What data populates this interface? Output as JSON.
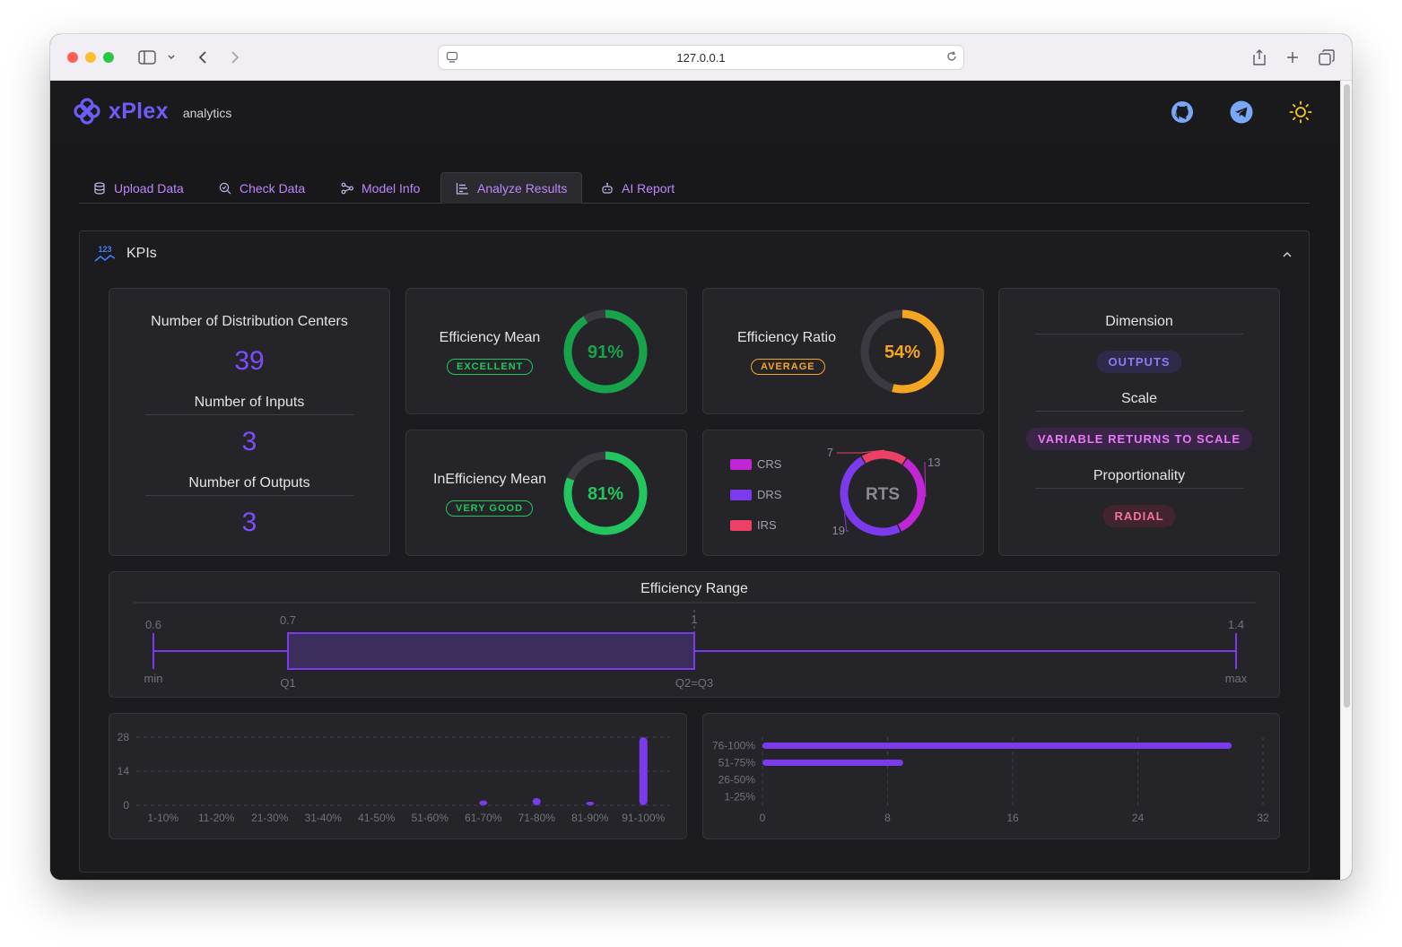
{
  "browser": {
    "url": "127.0.0.1"
  },
  "app": {
    "brand": "xPlex",
    "subtitle": "analytics"
  },
  "tabs": [
    {
      "label": "Upload Data",
      "icon": "database-icon"
    },
    {
      "label": "Check Data",
      "icon": "search-check-icon"
    },
    {
      "label": "Model Info",
      "icon": "workflow-icon"
    },
    {
      "label": "Analyze Results",
      "icon": "chart-report-icon",
      "active": true
    },
    {
      "label": "AI Report",
      "icon": "bot-icon"
    }
  ],
  "kpi_panel": {
    "icon_text": "123",
    "title": "KPIs"
  },
  "counts": {
    "dc_label": "Number of Distribution Centers",
    "dc_value": "39",
    "inputs_label": "Number of Inputs",
    "inputs_value": "3",
    "outputs_label": "Number of Outputs",
    "outputs_value": "3"
  },
  "gauges": [
    {
      "label": "Efficiency Mean",
      "value_text": "91%",
      "value": 0.91,
      "badge": "EXCELLENT",
      "color": "#16a34a",
      "badge_color": "#22c55e"
    },
    {
      "label": "Efficiency Ratio",
      "value_text": "54%",
      "value": 0.54,
      "badge": "AVERAGE",
      "color": "#f5a524",
      "badge_color": "#f5a524"
    },
    {
      "label": "InEfficiency Mean",
      "value_text": "81%",
      "value": 0.81,
      "badge": "VERY GOOD",
      "color": "#22c55e",
      "badge_color": "#22c55e"
    }
  ],
  "rts": {
    "center": "RTS",
    "legend": [
      {
        "name": "CRS",
        "color": "#c026d3"
      },
      {
        "name": "DRS",
        "color": "#7c3aed"
      },
      {
        "name": "IRS",
        "color": "#ec4066"
      }
    ],
    "values": {
      "IRS": 7,
      "CRS": 13,
      "DRS": 19
    }
  },
  "dimension": {
    "dimension_label": "Dimension",
    "dimension_value": "OUTPUTS",
    "scale_label": "Scale",
    "scale_value": "VARIABLE RETURNS TO SCALE",
    "prop_label": "Proportionality",
    "prop_value": "RADIAL"
  },
  "range": {
    "title": "Efficiency Range",
    "min": 0.6,
    "q1": 0.7,
    "median": 1,
    "max": 1.4,
    "labels": {
      "min": "min",
      "q1": "Q1",
      "q2q3": "Q2=Q3",
      "max": "max"
    },
    "ticks": {
      "min": "0.6",
      "q1": "0.7",
      "median": "1",
      "max": "1.4"
    }
  },
  "chart_data": [
    {
      "type": "bar",
      "categories": [
        "1-10%",
        "11-20%",
        "21-30%",
        "31-40%",
        "41-50%",
        "51-60%",
        "61-70%",
        "71-80%",
        "81-90%",
        "91-100%"
      ],
      "values": [
        0,
        0,
        0,
        0,
        0,
        0,
        2,
        3,
        0.5,
        28
      ],
      "yticks": [
        0,
        14,
        28
      ],
      "ylim": [
        0,
        28
      ],
      "color": "#7c3aed"
    },
    {
      "type": "bar",
      "orientation": "horizontal",
      "categories": [
        "76-100%",
        "51-75%",
        "26-50%",
        "1-25%"
      ],
      "values": [
        30,
        9,
        0,
        0
      ],
      "xticks": [
        0,
        8,
        16,
        24,
        32
      ],
      "xlim": [
        0,
        32
      ],
      "color": "#7c3aed"
    }
  ]
}
